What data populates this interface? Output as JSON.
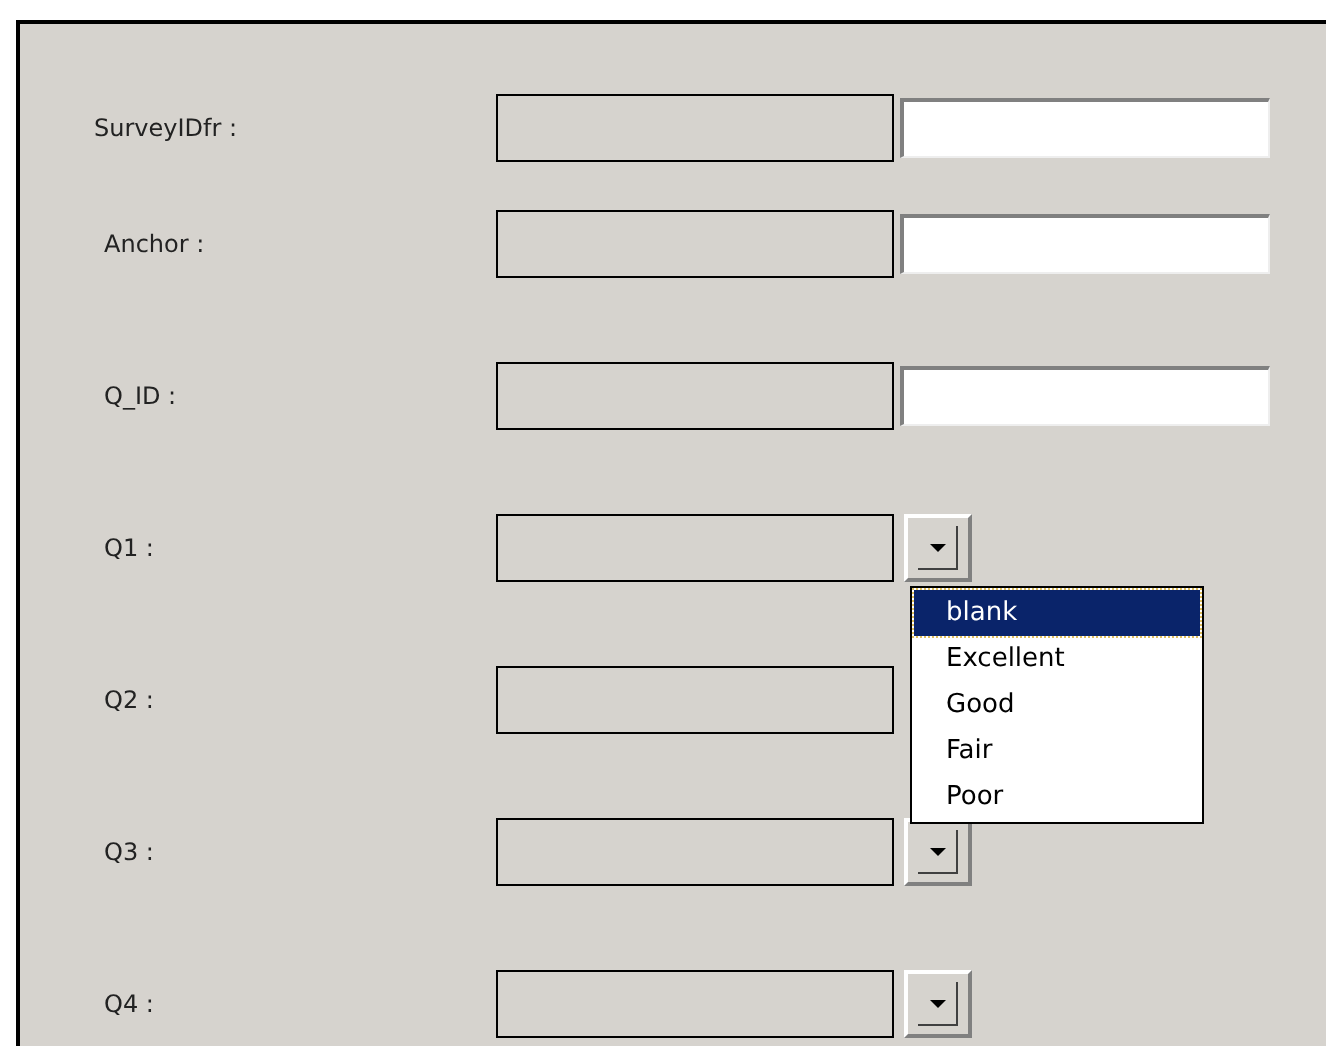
{
  "fields": [
    {
      "label": "SurveyIDfr :",
      "kind": "text"
    },
    {
      "label": "Anchor :",
      "kind": "text"
    },
    {
      "label": "Q_ID :",
      "kind": "text"
    },
    {
      "label": "Q1 :",
      "kind": "combo",
      "expanded": true,
      "options": [
        {
          "label": "blank",
          "selected": true
        },
        {
          "label": "Excellent",
          "selected": false
        },
        {
          "label": "Good",
          "selected": false
        },
        {
          "label": "Fair",
          "selected": false
        },
        {
          "label": "Poor",
          "selected": false
        }
      ]
    },
    {
      "label": "Q2 :",
      "kind": "combo"
    },
    {
      "label": "Q3 :",
      "kind": "combo"
    },
    {
      "label": "Q4 :",
      "kind": "combo"
    }
  ]
}
